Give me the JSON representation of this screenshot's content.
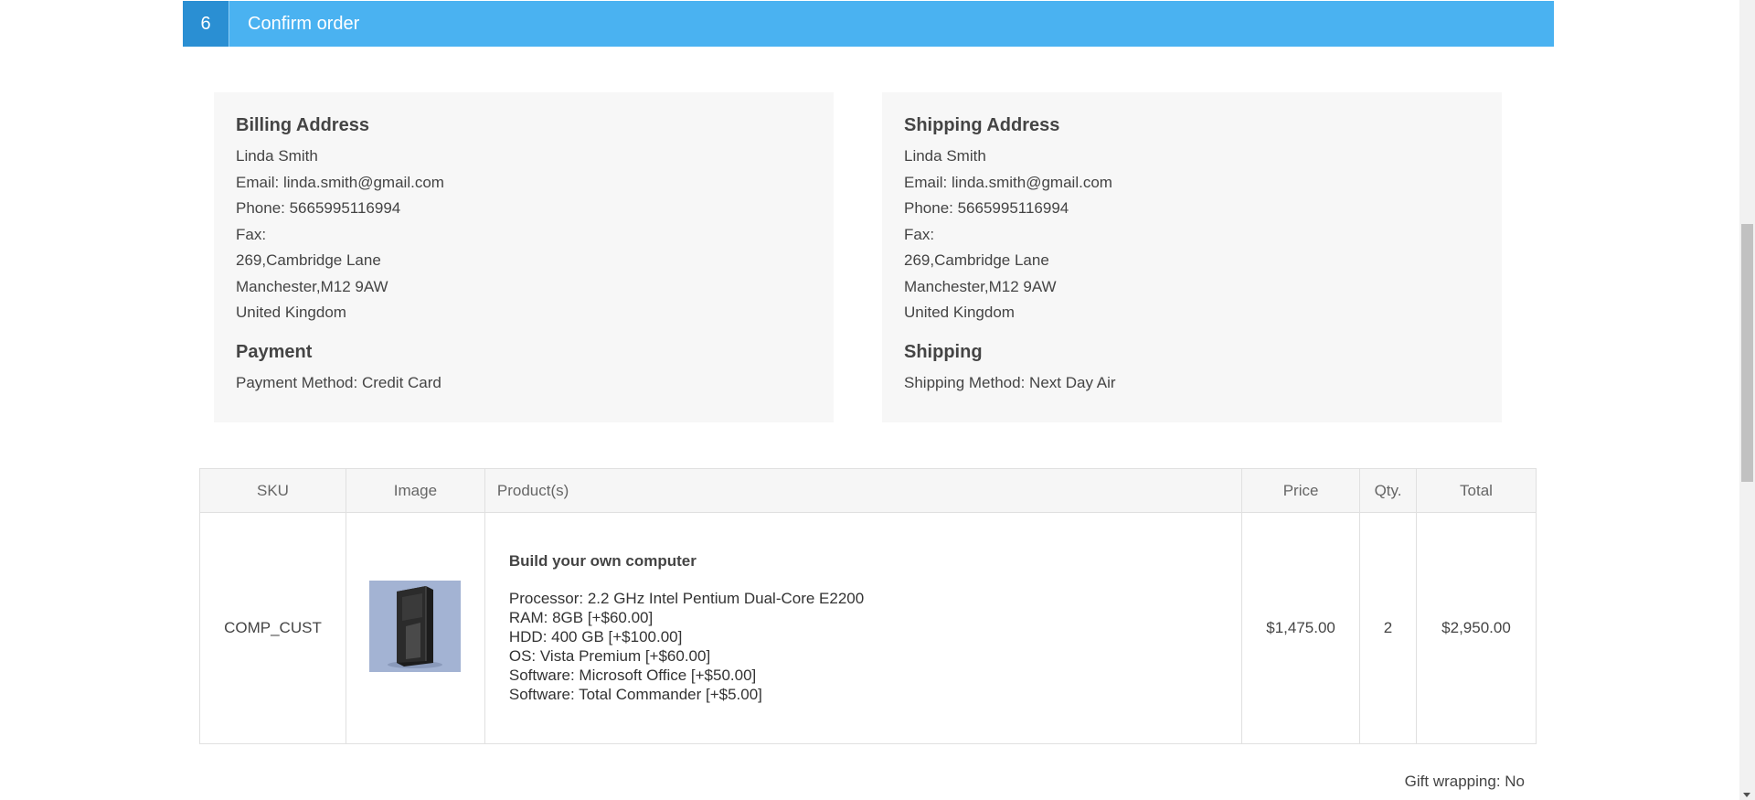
{
  "step": {
    "number": "6",
    "title": "Confirm order"
  },
  "billing": {
    "title": "Billing Address",
    "name": "Linda Smith",
    "email": "Email: linda.smith@gmail.com",
    "phone": "Phone: 5665995116994",
    "fax": "Fax:",
    "address1": "269,Cambridge Lane",
    "city": "Manchester,M12 9AW",
    "country": "United Kingdom"
  },
  "payment": {
    "title": "Payment",
    "method": "Payment Method: Credit Card"
  },
  "shipping_address": {
    "title": "Shipping Address",
    "name": "Linda Smith",
    "email": "Email: linda.smith@gmail.com",
    "phone": "Phone: 5665995116994",
    "fax": "Fax:",
    "address1": "269,Cambridge Lane",
    "city": "Manchester,M12 9AW",
    "country": "United Kingdom"
  },
  "shipping": {
    "title": "Shipping",
    "method": "Shipping Method: Next Day Air"
  },
  "table": {
    "headers": {
      "sku": "SKU",
      "image": "Image",
      "products": "Product(s)",
      "price": "Price",
      "qty": "Qty.",
      "total": "Total"
    },
    "rows": [
      {
        "sku": "COMP_CUST",
        "image_icon": "computer-tower-image",
        "product_name": "Build your own computer",
        "attributes": [
          "Processor: 2.2 GHz Intel Pentium Dual-Core E2200",
          "RAM: 8GB [+$60.00]",
          "HDD: 400 GB [+$100.00]",
          "OS: Vista Premium [+$60.00]",
          "Software: Microsoft Office [+$50.00]",
          "Software: Total Commander [+$5.00]"
        ],
        "price": "$1,475.00",
        "qty": "2",
        "total": "$2,950.00"
      }
    ]
  },
  "gift_wrapping": "Gift wrapping: No"
}
